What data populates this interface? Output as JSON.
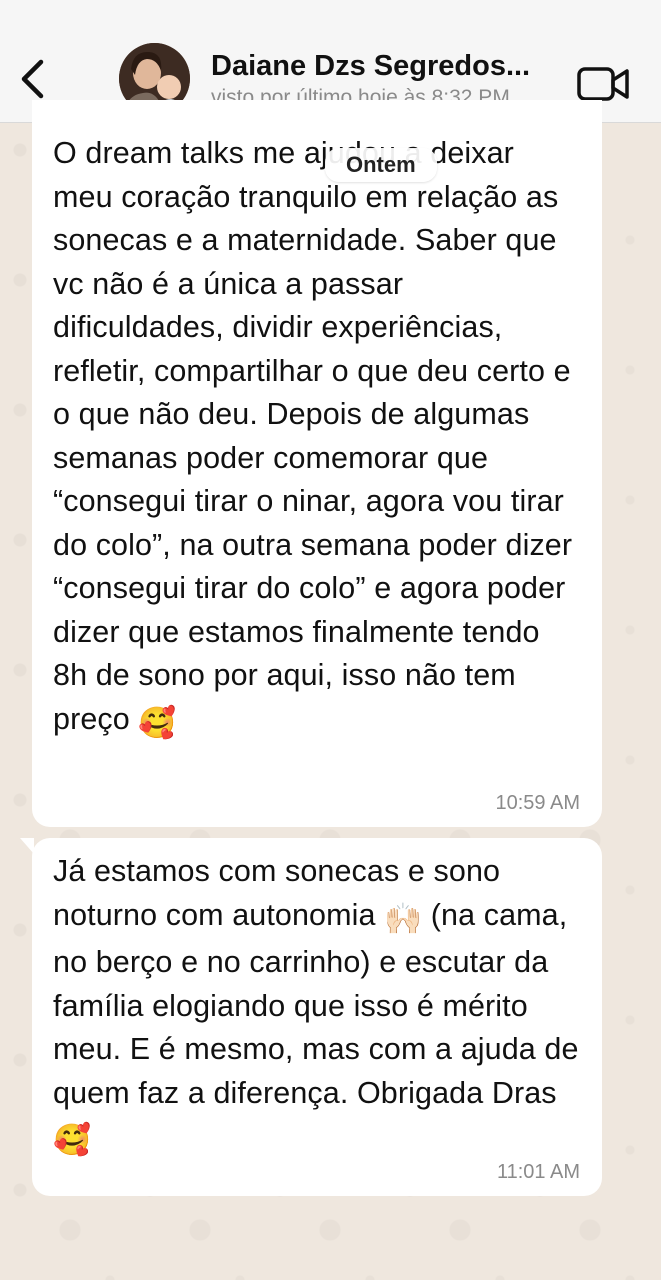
{
  "header": {
    "contact_name": "Daiane Dzs Segredos...",
    "last_seen": "visto por último hoje às 8:32 PM",
    "back_icon": "chevron-left-icon",
    "video_icon": "video-camera-icon"
  },
  "date_chip": "Ontem",
  "messages": [
    {
      "text": "O dream talks me ajudou a deixar meu coração tranquilo em relação as sonecas e a maternidade. Saber que vc não é a única a passar dificuldades, dividir experiências, refletir, compartilhar o que deu certo e o que não deu. Depois de algumas semanas poder comemorar que “consegui tirar o ninar, agora vou tirar do colo”, na outra semana poder dizer “consegui tirar do colo” e agora poder dizer que estamos finalmente tendo 8h de sono por aqui, isso não tem preço",
      "emoji": "🥰",
      "time": "10:59 AM"
    },
    {
      "text_a": "Já estamos com sonecas e sono noturno com autonomia",
      "emoji_a": "🙌🏻",
      "text_b": "(na cama, no berço e no carrinho) e escutar da família elogiando que isso é mérito meu. E é mesmo, mas com a ajuda de quem faz a diferença. Obrigada Dras",
      "emoji_b": "🥰",
      "time": "11:01 AM"
    }
  ],
  "colors": {
    "wallpaper": "#efe7de",
    "header_bg": "#f6f6f6",
    "bubble_bg": "#ffffff",
    "meta_text": "#8a8a8a"
  }
}
